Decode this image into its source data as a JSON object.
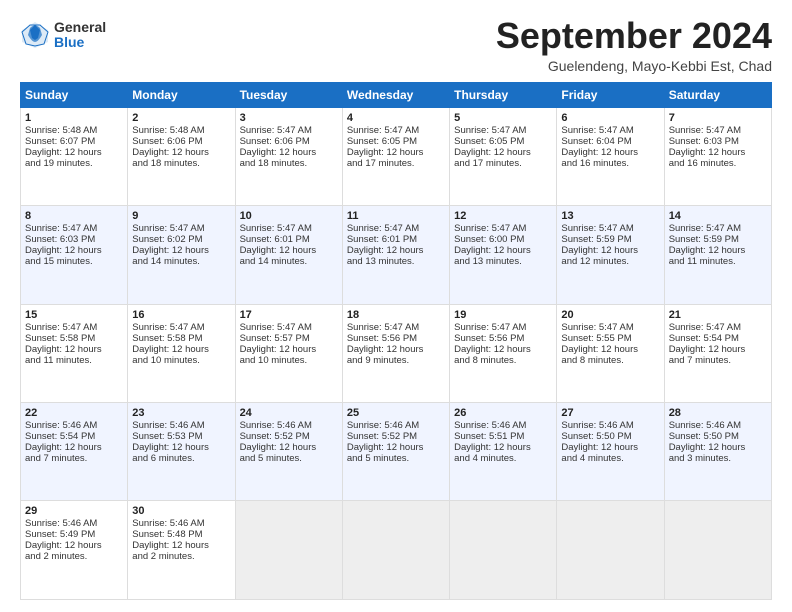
{
  "header": {
    "logo_general": "General",
    "logo_blue": "Blue",
    "month_title": "September 2024",
    "location": "Guelendeng, Mayo-Kebbi Est, Chad"
  },
  "weekdays": [
    "Sunday",
    "Monday",
    "Tuesday",
    "Wednesday",
    "Thursday",
    "Friday",
    "Saturday"
  ],
  "weeks": [
    [
      {
        "day": 1,
        "lines": [
          "Sunrise: 5:48 AM",
          "Sunset: 6:07 PM",
          "Daylight: 12 hours",
          "and 19 minutes."
        ]
      },
      {
        "day": 2,
        "lines": [
          "Sunrise: 5:48 AM",
          "Sunset: 6:06 PM",
          "Daylight: 12 hours",
          "and 18 minutes."
        ]
      },
      {
        "day": 3,
        "lines": [
          "Sunrise: 5:47 AM",
          "Sunset: 6:06 PM",
          "Daylight: 12 hours",
          "and 18 minutes."
        ]
      },
      {
        "day": 4,
        "lines": [
          "Sunrise: 5:47 AM",
          "Sunset: 6:05 PM",
          "Daylight: 12 hours",
          "and 17 minutes."
        ]
      },
      {
        "day": 5,
        "lines": [
          "Sunrise: 5:47 AM",
          "Sunset: 6:05 PM",
          "Daylight: 12 hours",
          "and 17 minutes."
        ]
      },
      {
        "day": 6,
        "lines": [
          "Sunrise: 5:47 AM",
          "Sunset: 6:04 PM",
          "Daylight: 12 hours",
          "and 16 minutes."
        ]
      },
      {
        "day": 7,
        "lines": [
          "Sunrise: 5:47 AM",
          "Sunset: 6:03 PM",
          "Daylight: 12 hours",
          "and 16 minutes."
        ]
      }
    ],
    [
      {
        "day": 8,
        "lines": [
          "Sunrise: 5:47 AM",
          "Sunset: 6:03 PM",
          "Daylight: 12 hours",
          "and 15 minutes."
        ]
      },
      {
        "day": 9,
        "lines": [
          "Sunrise: 5:47 AM",
          "Sunset: 6:02 PM",
          "Daylight: 12 hours",
          "and 14 minutes."
        ]
      },
      {
        "day": 10,
        "lines": [
          "Sunrise: 5:47 AM",
          "Sunset: 6:01 PM",
          "Daylight: 12 hours",
          "and 14 minutes."
        ]
      },
      {
        "day": 11,
        "lines": [
          "Sunrise: 5:47 AM",
          "Sunset: 6:01 PM",
          "Daylight: 12 hours",
          "and 13 minutes."
        ]
      },
      {
        "day": 12,
        "lines": [
          "Sunrise: 5:47 AM",
          "Sunset: 6:00 PM",
          "Daylight: 12 hours",
          "and 13 minutes."
        ]
      },
      {
        "day": 13,
        "lines": [
          "Sunrise: 5:47 AM",
          "Sunset: 5:59 PM",
          "Daylight: 12 hours",
          "and 12 minutes."
        ]
      },
      {
        "day": 14,
        "lines": [
          "Sunrise: 5:47 AM",
          "Sunset: 5:59 PM",
          "Daylight: 12 hours",
          "and 11 minutes."
        ]
      }
    ],
    [
      {
        "day": 15,
        "lines": [
          "Sunrise: 5:47 AM",
          "Sunset: 5:58 PM",
          "Daylight: 12 hours",
          "and 11 minutes."
        ]
      },
      {
        "day": 16,
        "lines": [
          "Sunrise: 5:47 AM",
          "Sunset: 5:58 PM",
          "Daylight: 12 hours",
          "and 10 minutes."
        ]
      },
      {
        "day": 17,
        "lines": [
          "Sunrise: 5:47 AM",
          "Sunset: 5:57 PM",
          "Daylight: 12 hours",
          "and 10 minutes."
        ]
      },
      {
        "day": 18,
        "lines": [
          "Sunrise: 5:47 AM",
          "Sunset: 5:56 PM",
          "Daylight: 12 hours",
          "and 9 minutes."
        ]
      },
      {
        "day": 19,
        "lines": [
          "Sunrise: 5:47 AM",
          "Sunset: 5:56 PM",
          "Daylight: 12 hours",
          "and 8 minutes."
        ]
      },
      {
        "day": 20,
        "lines": [
          "Sunrise: 5:47 AM",
          "Sunset: 5:55 PM",
          "Daylight: 12 hours",
          "and 8 minutes."
        ]
      },
      {
        "day": 21,
        "lines": [
          "Sunrise: 5:47 AM",
          "Sunset: 5:54 PM",
          "Daylight: 12 hours",
          "and 7 minutes."
        ]
      }
    ],
    [
      {
        "day": 22,
        "lines": [
          "Sunrise: 5:46 AM",
          "Sunset: 5:54 PM",
          "Daylight: 12 hours",
          "and 7 minutes."
        ]
      },
      {
        "day": 23,
        "lines": [
          "Sunrise: 5:46 AM",
          "Sunset: 5:53 PM",
          "Daylight: 12 hours",
          "and 6 minutes."
        ]
      },
      {
        "day": 24,
        "lines": [
          "Sunrise: 5:46 AM",
          "Sunset: 5:52 PM",
          "Daylight: 12 hours",
          "and 5 minutes."
        ]
      },
      {
        "day": 25,
        "lines": [
          "Sunrise: 5:46 AM",
          "Sunset: 5:52 PM",
          "Daylight: 12 hours",
          "and 5 minutes."
        ]
      },
      {
        "day": 26,
        "lines": [
          "Sunrise: 5:46 AM",
          "Sunset: 5:51 PM",
          "Daylight: 12 hours",
          "and 4 minutes."
        ]
      },
      {
        "day": 27,
        "lines": [
          "Sunrise: 5:46 AM",
          "Sunset: 5:50 PM",
          "Daylight: 12 hours",
          "and 4 minutes."
        ]
      },
      {
        "day": 28,
        "lines": [
          "Sunrise: 5:46 AM",
          "Sunset: 5:50 PM",
          "Daylight: 12 hours",
          "and 3 minutes."
        ]
      }
    ],
    [
      {
        "day": 29,
        "lines": [
          "Sunrise: 5:46 AM",
          "Sunset: 5:49 PM",
          "Daylight: 12 hours",
          "and 2 minutes."
        ]
      },
      {
        "day": 30,
        "lines": [
          "Sunrise: 5:46 AM",
          "Sunset: 5:48 PM",
          "Daylight: 12 hours",
          "and 2 minutes."
        ]
      },
      null,
      null,
      null,
      null,
      null
    ]
  ]
}
